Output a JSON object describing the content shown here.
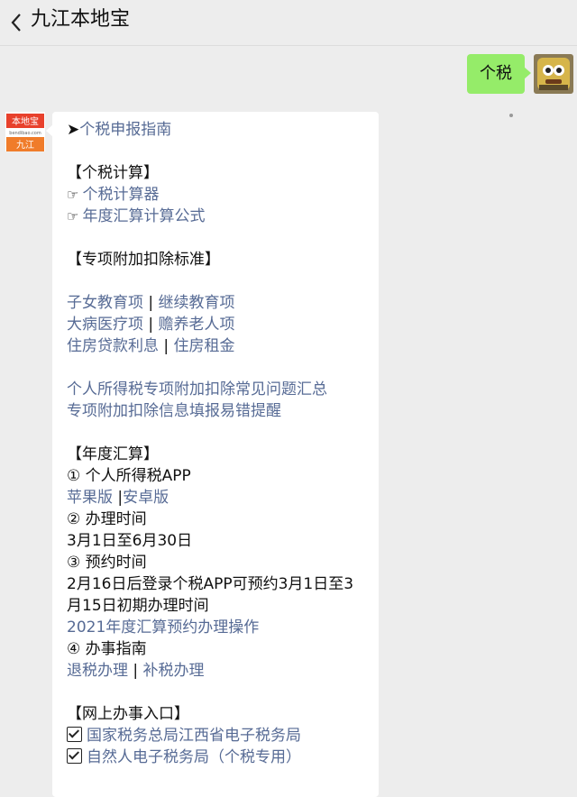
{
  "header": {
    "title": "九江本地宝"
  },
  "user_message": {
    "text": "个税"
  },
  "bot_avatar": {
    "brand_top": "本地宝",
    "brand_url": "bendibao.com",
    "brand_city": "九江"
  },
  "reply": {
    "guide_link": "个税申报指南",
    "calc_heading": "【个税计算】",
    "calc_links": [
      "个税计算器",
      "年度汇算计算公式"
    ],
    "deduction_heading": "【专项附加扣除标准】",
    "deduction_pairs": [
      [
        "子女教育项",
        "继续教育项"
      ],
      [
        "大病医疗项",
        "赡养老人项"
      ],
      [
        "住房贷款利息",
        "住房租金"
      ]
    ],
    "deduction_links": [
      "个人所得税专项附加扣除常见问题汇总",
      "专项附加扣除信息填报易错提醒"
    ],
    "annual_heading": "【年度汇算】",
    "step1": "① 个人所得税APP",
    "app_links": [
      "苹果版",
      "安卓版"
    ],
    "step2": "② 办理时间",
    "time_range": "3月1日至6月30日",
    "step3": "③ 预约时间",
    "appoint_line1": "2月16日后登录个税APP可预约3月1日至3",
    "appoint_line2": "月15日初期办理时间",
    "appoint_link": "2021年度汇算预约办理操作",
    "step4": "④ 办事指南",
    "guide_pair": [
      "退税办理",
      "补税办理"
    ],
    "online_heading": "【网上办事入口】",
    "online_links": [
      "国家税务总局江西省电子税务局",
      "自然人电子税务局（个税专用）"
    ]
  },
  "colors": {
    "link": "#576b95",
    "bubble": "#95ec69",
    "background": "#ededed"
  }
}
